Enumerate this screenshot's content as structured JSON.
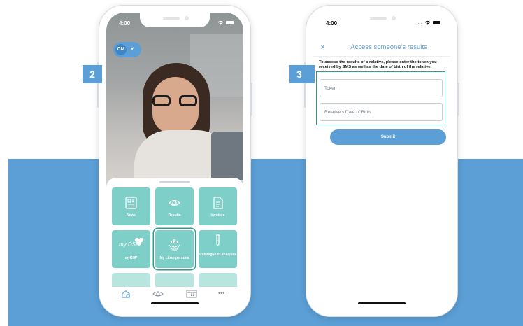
{
  "phone1": {
    "time": "4:00",
    "avatar_initials": "CM",
    "tiles": [
      {
        "label": "News",
        "icon": "news-icon"
      },
      {
        "label": "Results",
        "icon": "eye-icon"
      },
      {
        "label": "Invoices",
        "icon": "document-icon"
      },
      {
        "label": "myDSP",
        "icon": "mydsp-logo",
        "logo_text": "my DSP"
      },
      {
        "label": "My close persons",
        "icon": "hands-icon"
      },
      {
        "label": "Catalogue of analyses",
        "icon": "test-tube-icon"
      }
    ],
    "tabbar": {
      "more": "•••"
    }
  },
  "phone2": {
    "time": "4:00",
    "close": "×",
    "title": "Access someone's results",
    "instructions": "To access the results of a relative, please enter the token you received by SMS as well as the date of birth of the relative.",
    "token_placeholder": "Token",
    "dob_placeholder": "Relative's Date of Birth",
    "submit": "Submit"
  },
  "steps": {
    "step2": "2",
    "step3": "3"
  },
  "colors": {
    "accent_blue": "#5b9fd6",
    "tile_teal": "#7ecfc7",
    "highlight": "#2a9d8f"
  }
}
